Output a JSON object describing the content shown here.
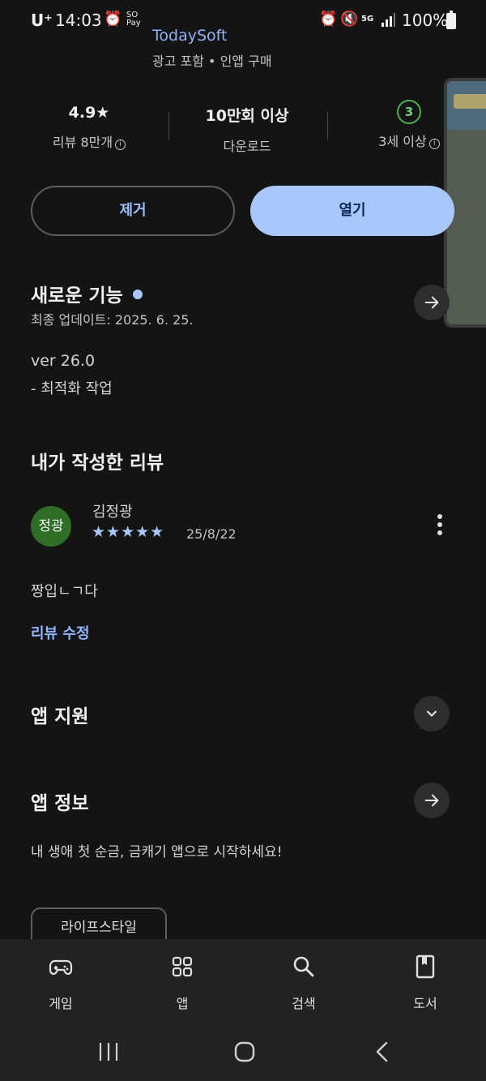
{
  "status_bar": {
    "carrier": "U⁺",
    "time": "14:03",
    "battery": "100%",
    "network": "5G"
  },
  "app": {
    "developer": "TodaySoft",
    "meta": "광고 포함 • 인앱 구매"
  },
  "stats": {
    "rating_value": "4.9★",
    "rating_label": "리뷰 8만개",
    "downloads_value": "10만회 이상",
    "downloads_label": "다운로드",
    "age_value": "3",
    "age_label": "3세 이상"
  },
  "actions": {
    "remove": "제거",
    "open": "열기"
  },
  "whats_new": {
    "title": "새로운 기능",
    "updated": "최종 업데이트: 2025. 6. 25.",
    "version": "ver 26.0",
    "notes": "- 최적화 작업"
  },
  "my_review": {
    "title": "내가 작성한 리뷰",
    "avatar_text": "정광",
    "author": "김정광",
    "stars": "★★★★★",
    "rating": 5,
    "date": "25/8/22",
    "body": "짱입ㄴㄱ다",
    "edit_link": "리뷰 수정"
  },
  "app_support": {
    "title": "앱 지원"
  },
  "app_info": {
    "title": "앱 정보",
    "description": "내 생애 첫 순금, 금캐기 앱으로 시작하세요!",
    "category_chip": "라이프스타일"
  },
  "bottom_nav": [
    {
      "label": "게임",
      "icon": "gamepad-icon"
    },
    {
      "label": "앱",
      "icon": "apps-grid-icon"
    },
    {
      "label": "검색",
      "icon": "search-icon"
    },
    {
      "label": "도서",
      "icon": "book-icon"
    }
  ],
  "colors": {
    "background": "#141414",
    "accent": "#a8c7fa",
    "link": "#8fb4ff",
    "avatar": "#2f6e27"
  }
}
